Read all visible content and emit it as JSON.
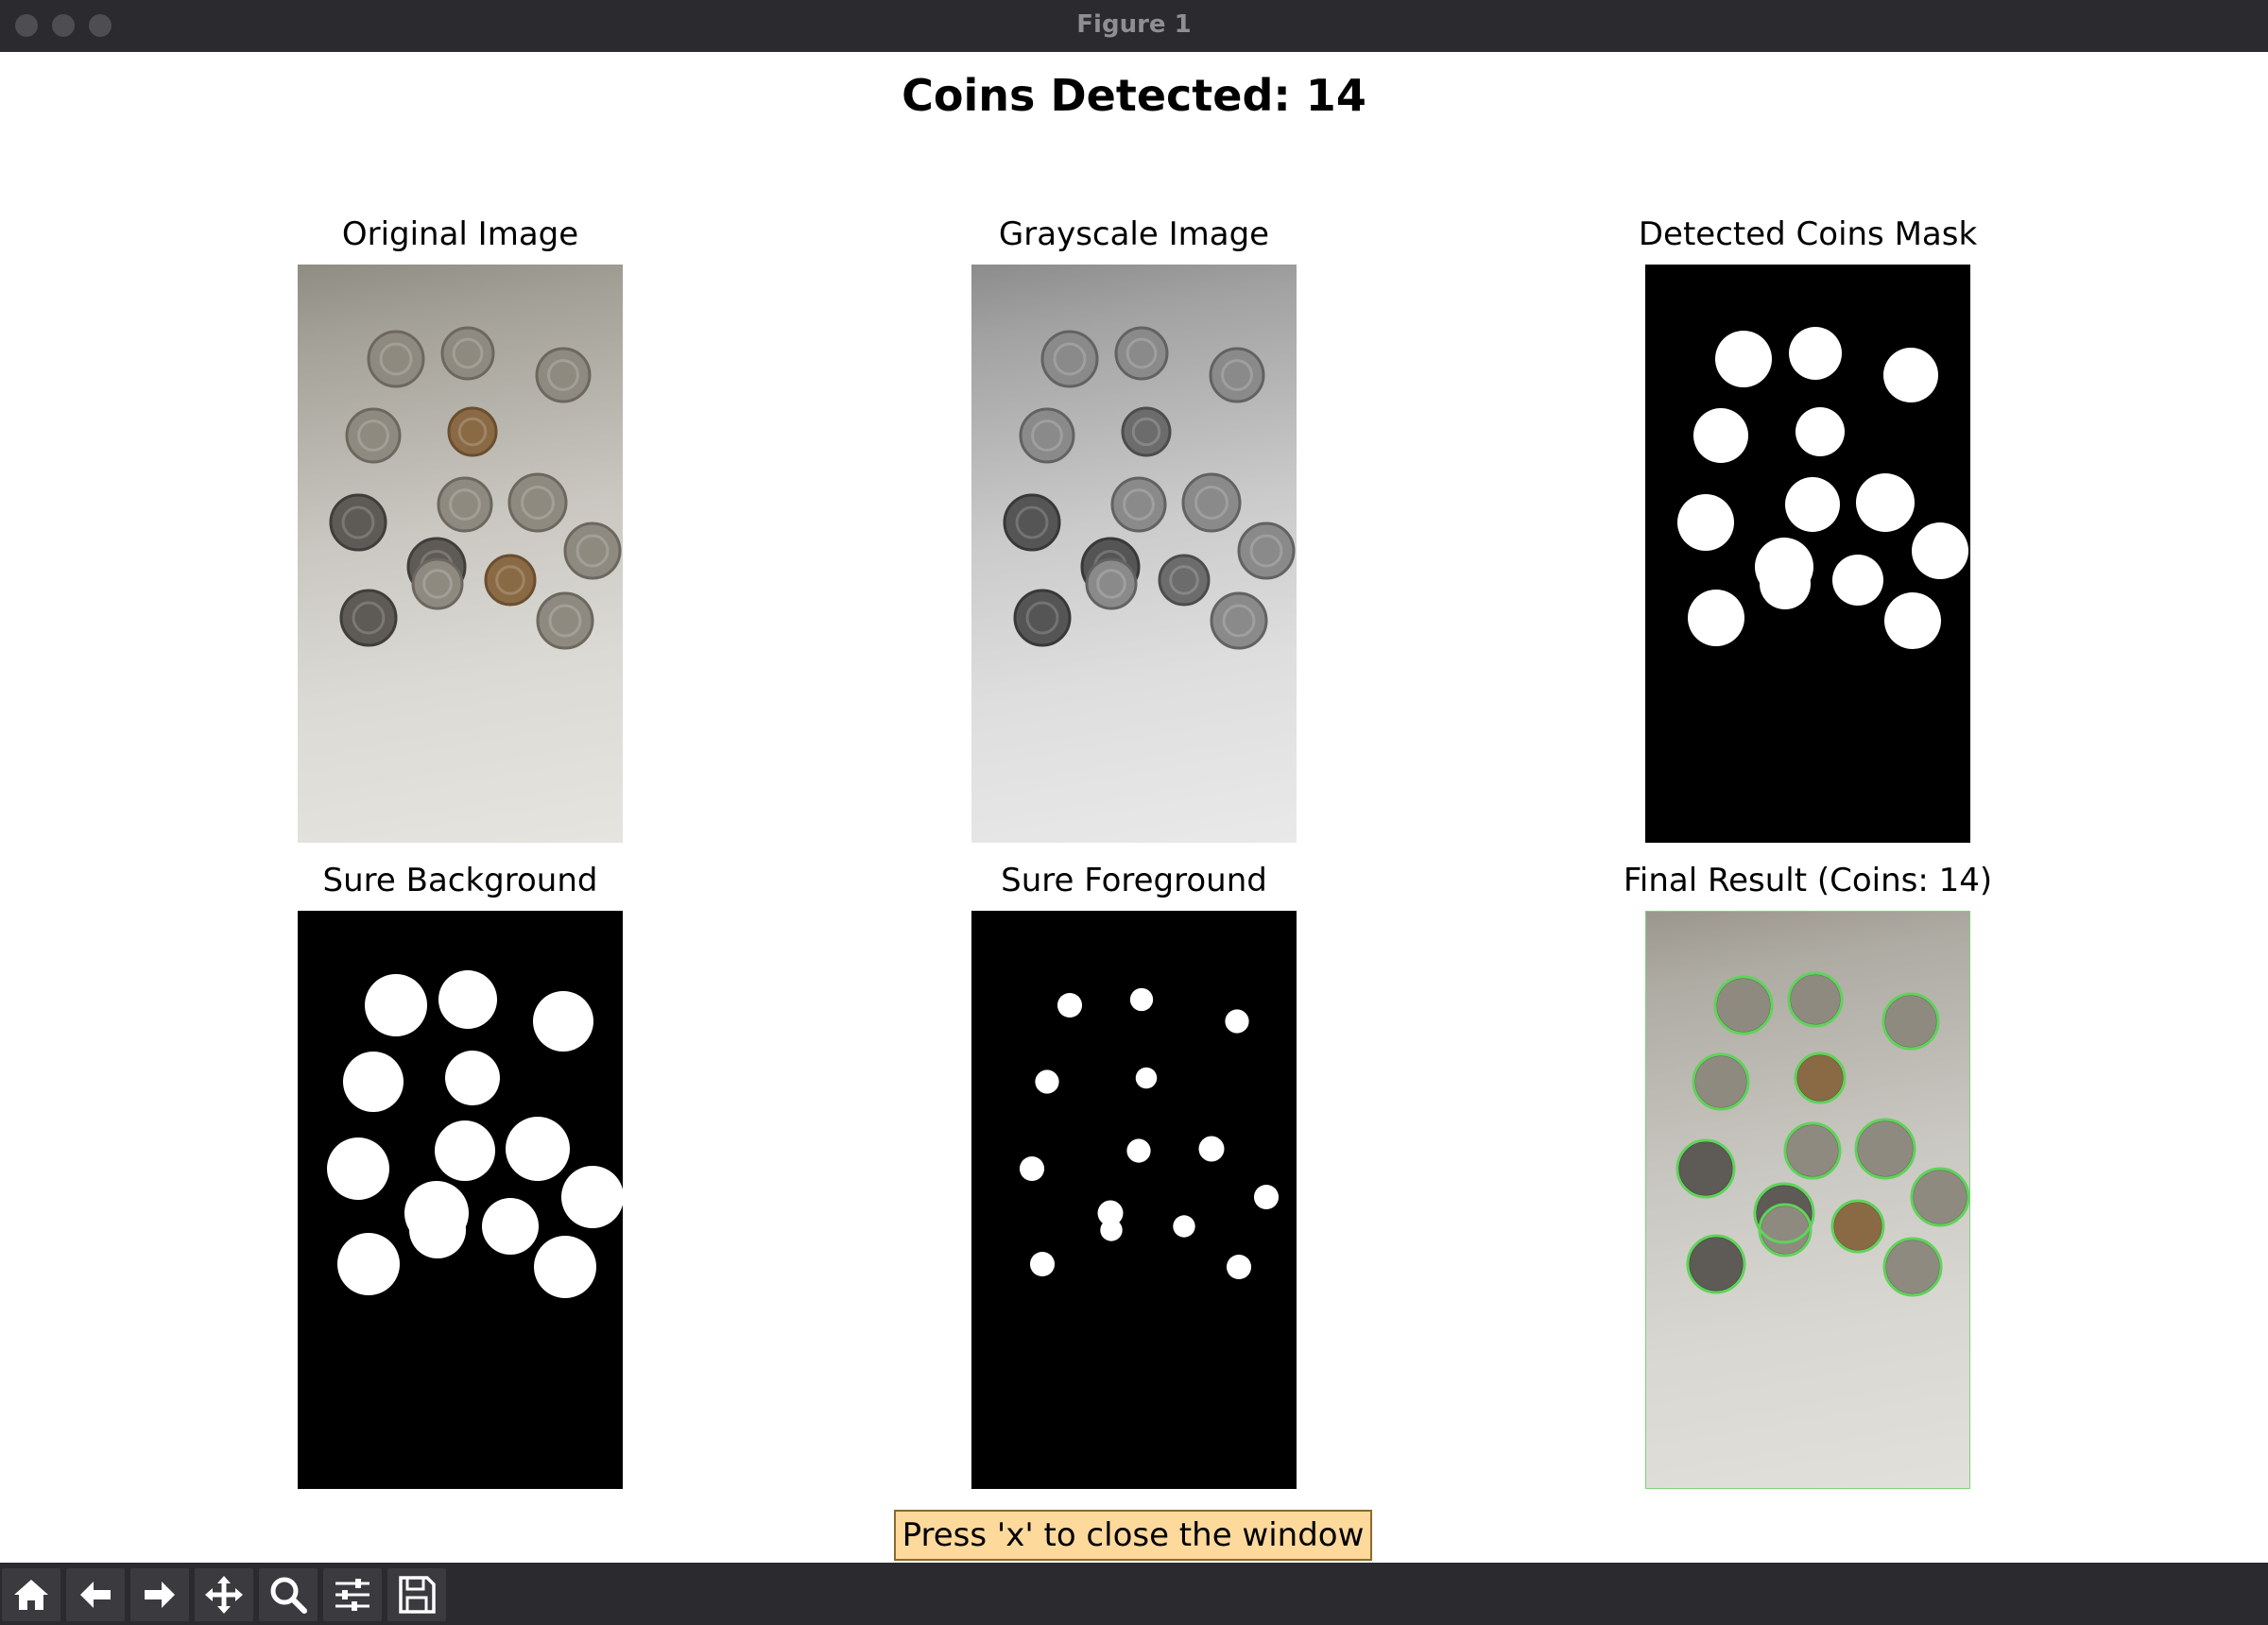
{
  "window": {
    "title": "Figure 1"
  },
  "figure": {
    "suptitle": "Coins Detected: 14"
  },
  "panels": [
    {
      "title": "Original Image"
    },
    {
      "title": "Grayscale Image"
    },
    {
      "title": "Detected Coins Mask"
    },
    {
      "title": "Sure Background"
    },
    {
      "title": "Sure Foreground"
    },
    {
      "title": "Final Result (Coins: 14)"
    }
  ],
  "tooltip": {
    "text": "Press 'x' to close the window"
  },
  "toolbar": {
    "buttons": [
      "home-icon",
      "back-arrow-icon",
      "forward-arrow-icon",
      "pan-icon",
      "zoom-icon",
      "configure-subplots-icon",
      "save-icon"
    ]
  },
  "colors": {
    "detection_outline": "#5fd35a",
    "titlebar": "#2b2b2f",
    "tooltip_bg": "#fdd99b"
  }
}
